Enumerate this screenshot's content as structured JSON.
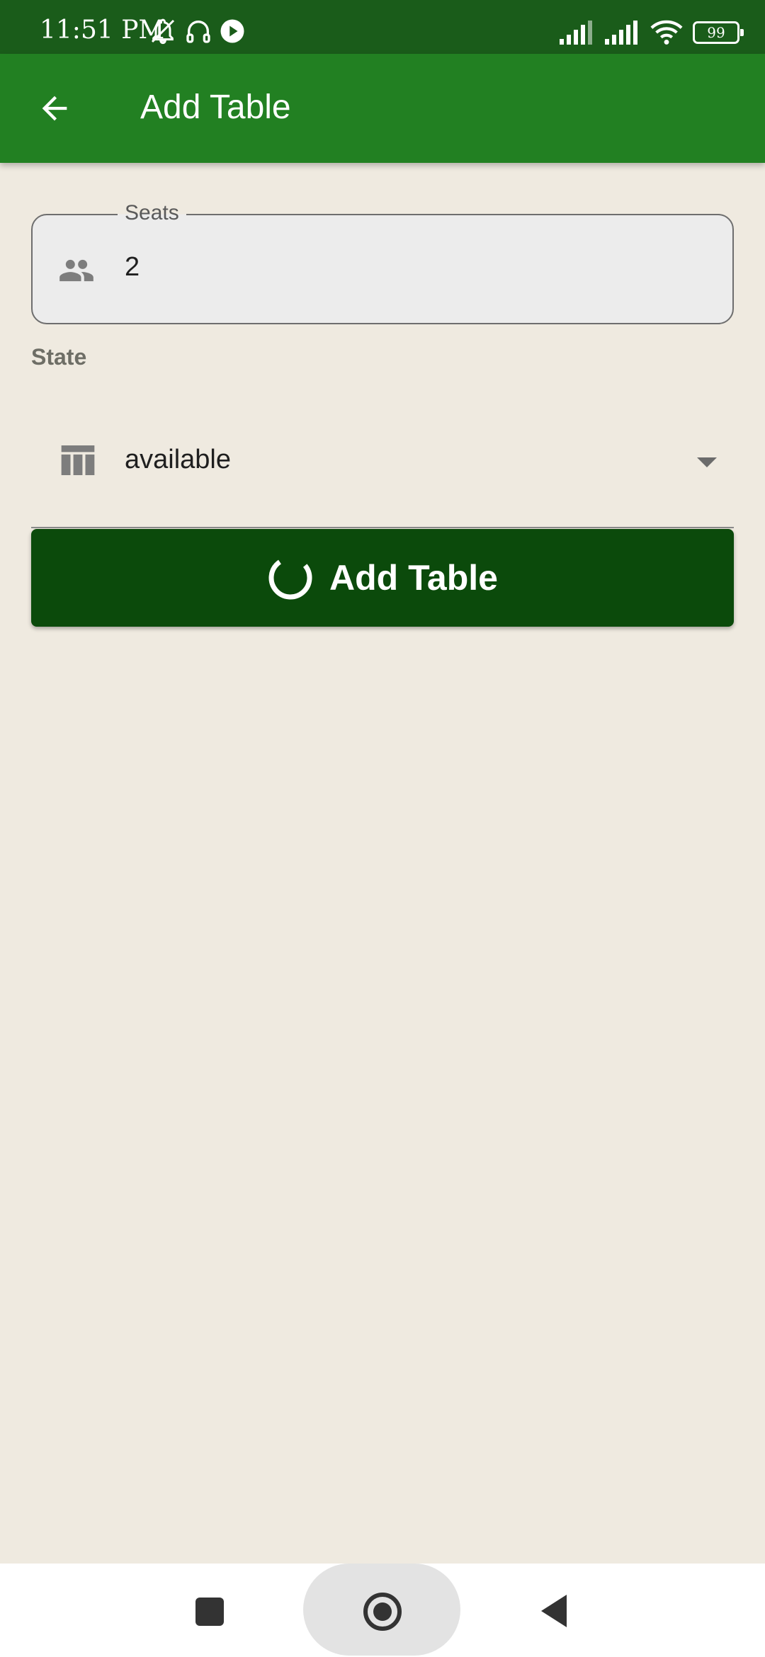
{
  "status_bar": {
    "time": "11:51 PM",
    "battery": "99",
    "icons": [
      "bell-off-icon",
      "headset-icon",
      "play-icon",
      "signal-icon",
      "signal-icon",
      "wifi-icon",
      "battery-icon"
    ]
  },
  "app_bar": {
    "title": "Add Table",
    "back_icon": "arrow-left-icon"
  },
  "form": {
    "seats": {
      "label": "Seats",
      "value": "2",
      "icon": "people-icon"
    },
    "state": {
      "label": "State",
      "value": "available",
      "icon": "table-icon"
    },
    "submit": {
      "label": "Add Table",
      "loading": true
    }
  },
  "nav_bar": {
    "icons": [
      "recents-icon",
      "home-icon",
      "back-icon"
    ]
  },
  "colors": {
    "status_bar": "#1a5c1a",
    "app_bar": "#228022",
    "background": "#efeae0",
    "button": "#0b4a0b"
  }
}
